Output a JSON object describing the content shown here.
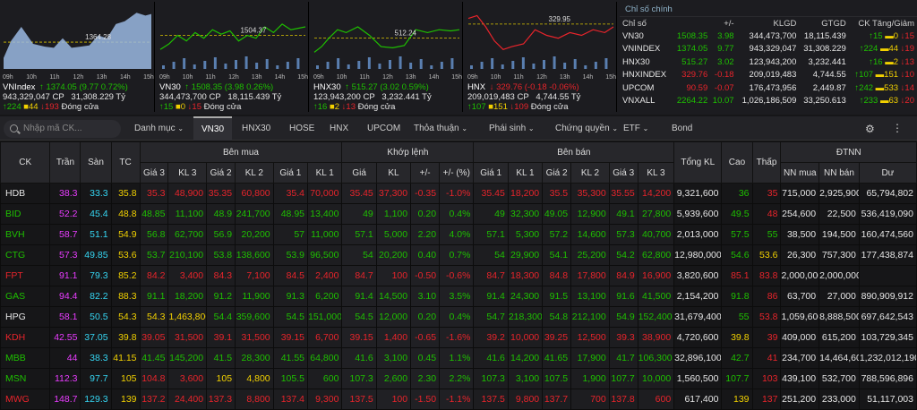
{
  "charts": [
    {
      "name": "VNIndex",
      "value": "1374.05",
      "change": "(9.77 0.72%)",
      "vol": "943,329,047 CP",
      "val": "31,308.229 Tỷ",
      "dir": "up",
      "up": "224",
      "ref": "44",
      "down": "193",
      "status": "Đóng cửa",
      "label": "1364.28",
      "times": [
        "09h",
        "10h",
        "11h",
        "12h",
        "13h",
        "14h",
        "15h"
      ]
    },
    {
      "name": "VN30",
      "value": "1508.35",
      "change": "(3.98 0.26%)",
      "vol": "344,473,700 CP",
      "val": "18,115.439 Tỷ",
      "dir": "up",
      "up": "15",
      "ref": "0",
      "down": "15",
      "status": "Đóng cửa",
      "label": "1504.37",
      "times": [
        "09h",
        "10h",
        "11h",
        "12h",
        "13h",
        "14h",
        "15h"
      ]
    },
    {
      "name": "HNX30",
      "value": "515.27",
      "change": "(3.02 0.59%)",
      "vol": "123,943,200 CP",
      "val": "3,232.441 Tỷ",
      "dir": "up",
      "up": "16",
      "ref": "2",
      "down": "13",
      "status": "Đóng cửa",
      "label": "512.24",
      "times": [
        "09h",
        "10h",
        "11h",
        "12h",
        "13h",
        "14h",
        "15h"
      ]
    },
    {
      "name": "HNX",
      "value": "329.76",
      "change": "(-0.18 -0.06%)",
      "vol": "209,019,483 CP",
      "val": "4,744.55 Tỷ",
      "dir": "dn",
      "up": "107",
      "ref": "151",
      "down": "109",
      "status": "Đóng cửa",
      "label": "329.95",
      "times": [
        "09h",
        "10h",
        "11h",
        "12h",
        "13h",
        "14h",
        "15h"
      ]
    }
  ],
  "index_panel": {
    "title": "Chỉ số chính",
    "headers": [
      "Chỉ số",
      "+/-",
      "KLGD",
      "GTGD",
      "CK Tăng/Giảm"
    ],
    "rows": [
      {
        "name": "VN30",
        "value": "1508.35",
        "chg": "3.98",
        "klgd": "344,473,700",
        "gtgd": "18,115.439",
        "up": "15",
        "ref": "0",
        "down": "15",
        "dir": "up"
      },
      {
        "name": "VNINDEX",
        "value": "1374.05",
        "chg": "9.77",
        "klgd": "943,329,047",
        "gtgd": "31,308.229",
        "up": "224",
        "ref": "44",
        "down": "19",
        "dir": "up"
      },
      {
        "name": "HNX30",
        "value": "515.27",
        "chg": "3.02",
        "klgd": "123,943,200",
        "gtgd": "3,232.441",
        "up": "16",
        "ref": "2",
        "down": "13",
        "dir": "up"
      },
      {
        "name": "HNXINDEX",
        "value": "329.76",
        "chg": "-0.18",
        "klgd": "209,019,483",
        "gtgd": "4,744.55",
        "up": "107",
        "ref": "151",
        "down": "10",
        "dir": "dn"
      },
      {
        "name": "UPCOM",
        "value": "90.59",
        "chg": "-0.07",
        "klgd": "176,473,956",
        "gtgd": "2,449.87",
        "up": "242",
        "ref": "533",
        "down": "14",
        "dir": "dn"
      },
      {
        "name": "VNXALL",
        "value": "2264.22",
        "chg": "10.07",
        "klgd": "1,026,186,509",
        "gtgd": "33,250.613",
        "up": "233",
        "ref": "63",
        "down": "20",
        "dir": "up"
      }
    ]
  },
  "toolbar": {
    "search_placeholder": "Nhập mã CK...",
    "tabs": [
      "Danh mục",
      "VN30",
      "HNX30",
      "HOSE",
      "HNX",
      "UPCOM",
      "Thỏa thuận",
      "Phái sinh",
      "Chứng quyền",
      "ETF",
      "Bond"
    ],
    "active": "VN30"
  },
  "table": {
    "groups": {
      "ck": "CK",
      "tran": "Trần",
      "san": "Sàn",
      "tc": "TC",
      "benmua": "Bên mua",
      "khoplenh": "Khớp lệnh",
      "benban": "Bên bán",
      "tongkl": "Tổng KL",
      "cao": "Cao",
      "thap": "Thấp",
      "dtnn": "ĐTNN"
    },
    "sub": [
      "Giá 3",
      "KL 3",
      "Giá 2",
      "KL 2",
      "Giá 1",
      "KL 1",
      "Giá",
      "KL",
      "+/-",
      "+/- (%)",
      "Giá 1",
      "KL 1",
      "Giá 2",
      "KL 2",
      "Giá 3",
      "KL 3",
      "NN mua",
      "NN bán",
      "Dư"
    ],
    "rows": [
      {
        "c": [
          "HDB",
          "38.3",
          "33.3",
          "35.8",
          "35.3",
          "48,900",
          "35.35",
          "60,800",
          "35.4",
          "70,000",
          "35.45",
          "37,300",
          "-0.35",
          "-1.0%",
          "35.45",
          "18,200",
          "35.5",
          "35,300",
          "35.55",
          "14,200",
          "9,321,600",
          "36",
          "35",
          "715,000",
          "2,925,900",
          "65,794,802"
        ],
        "k": [
          "wt",
          "ce",
          "fl",
          "ref",
          "dn",
          "dn",
          "dn",
          "dn",
          "dn",
          "dn",
          "dn",
          "dn",
          "dn",
          "dn",
          "dn",
          "dn",
          "dn",
          "dn",
          "dn",
          "dn",
          "wt",
          "up",
          "dn",
          "wt",
          "wt",
          "wt"
        ]
      },
      {
        "c": [
          "BID",
          "52.2",
          "45.4",
          "48.8",
          "48.85",
          "11,100",
          "48.9",
          "241,700",
          "48.95",
          "13,400",
          "49",
          "1,100",
          "0.20",
          "0.4%",
          "49",
          "32,300",
          "49.05",
          "12,900",
          "49.1",
          "27,800",
          "5,939,600",
          "49.5",
          "48",
          "254,600",
          "22,500",
          "536,419,090"
        ],
        "k": [
          "up",
          "ce",
          "fl",
          "ref",
          "up",
          "up",
          "up",
          "up",
          "up",
          "up",
          "up",
          "up",
          "up",
          "up",
          "up",
          "up",
          "up",
          "up",
          "up",
          "up",
          "wt",
          "up",
          "dn",
          "wt",
          "wt",
          "wt"
        ]
      },
      {
        "c": [
          "BVH",
          "58.7",
          "51.1",
          "54.9",
          "56.8",
          "62,700",
          "56.9",
          "20,200",
          "57",
          "11,000",
          "57.1",
          "5,000",
          "2.20",
          "4.0%",
          "57.1",
          "5,300",
          "57.2",
          "14,600",
          "57.3",
          "40,700",
          "2,013,000",
          "57.5",
          "55",
          "38,500",
          "194,500",
          "160,474,560"
        ],
        "k": [
          "up",
          "ce",
          "fl",
          "ref",
          "up",
          "up",
          "up",
          "up",
          "up",
          "up",
          "up",
          "up",
          "up",
          "up",
          "up",
          "up",
          "up",
          "up",
          "up",
          "up",
          "wt",
          "up",
          "up",
          "wt",
          "wt",
          "wt"
        ]
      },
      {
        "c": [
          "CTG",
          "57.3",
          "49.85",
          "53.6",
          "53.7",
          "210,100",
          "53.8",
          "138,600",
          "53.9",
          "96,500",
          "54",
          "20,200",
          "0.40",
          "0.7%",
          "54",
          "29,900",
          "54.1",
          "25,200",
          "54.2",
          "62,800",
          "12,980,000",
          "54.6",
          "53.6",
          "26,300",
          "757,300",
          "177,438,874"
        ],
        "k": [
          "up",
          "ce",
          "fl",
          "ref",
          "up",
          "up",
          "up",
          "up",
          "up",
          "up",
          "up",
          "up",
          "up",
          "up",
          "up",
          "up",
          "up",
          "up",
          "up",
          "up",
          "wt",
          "up",
          "ref",
          "wt",
          "wt",
          "wt"
        ]
      },
      {
        "c": [
          "FPT",
          "91.1",
          "79.3",
          "85.2",
          "84.2",
          "3,400",
          "84.3",
          "7,100",
          "84.5",
          "2,400",
          "84.7",
          "100",
          "-0.50",
          "-0.6%",
          "84.7",
          "18,300",
          "84.8",
          "17,800",
          "84.9",
          "16,900",
          "3,820,600",
          "85.1",
          "83.8",
          "2,000,000",
          "2,000,000",
          ""
        ],
        "k": [
          "dn",
          "ce",
          "fl",
          "ref",
          "dn",
          "dn",
          "dn",
          "dn",
          "dn",
          "dn",
          "dn",
          "dn",
          "dn",
          "dn",
          "dn",
          "dn",
          "dn",
          "dn",
          "dn",
          "dn",
          "wt",
          "dn",
          "dn",
          "wt",
          "wt",
          "wt"
        ]
      },
      {
        "c": [
          "GAS",
          "94.4",
          "82.2",
          "88.3",
          "91.1",
          "18,200",
          "91.2",
          "11,900",
          "91.3",
          "6,200",
          "91.4",
          "14,500",
          "3.10",
          "3.5%",
          "91.4",
          "24,300",
          "91.5",
          "13,100",
          "91.6",
          "41,500",
          "2,154,200",
          "91.8",
          "86",
          "63,700",
          "27,000",
          "890,909,912"
        ],
        "k": [
          "up",
          "ce",
          "fl",
          "ref",
          "up",
          "up",
          "up",
          "up",
          "up",
          "up",
          "up",
          "up",
          "up",
          "up",
          "up",
          "up",
          "up",
          "up",
          "up",
          "up",
          "wt",
          "up",
          "dn",
          "wt",
          "wt",
          "wt"
        ]
      },
      {
        "c": [
          "HPG",
          "58.1",
          "50.5",
          "54.3",
          "54.3",
          "1,463,800",
          "54.4",
          "359,600",
          "54.5",
          "151,000",
          "54.5",
          "12,000",
          "0.20",
          "0.4%",
          "54.7",
          "218,300",
          "54.8",
          "212,100",
          "54.9",
          "152,400",
          "31,679,400",
          "55",
          "53.8",
          "1,059,600",
          "8,888,500",
          "697,642,543"
        ],
        "k": [
          "wt",
          "ce",
          "fl",
          "ref",
          "ref",
          "ref",
          "up",
          "up",
          "up",
          "up",
          "up",
          "up",
          "up",
          "up",
          "up",
          "up",
          "up",
          "up",
          "up",
          "up",
          "wt",
          "up",
          "dn",
          "wt",
          "wt",
          "wt"
        ]
      },
      {
        "c": [
          "KDH",
          "42.55",
          "37.05",
          "39.8",
          "39.05",
          "31,500",
          "39.1",
          "31,500",
          "39.15",
          "6,700",
          "39.15",
          "1,400",
          "-0.65",
          "-1.6%",
          "39.2",
          "10,000",
          "39.25",
          "12,500",
          "39.3",
          "38,900",
          "4,720,600",
          "39.8",
          "39",
          "409,000",
          "615,200",
          "103,729,345"
        ],
        "k": [
          "dn",
          "ce",
          "fl",
          "ref",
          "dn",
          "dn",
          "dn",
          "dn",
          "dn",
          "dn",
          "dn",
          "dn",
          "dn",
          "dn",
          "dn",
          "dn",
          "dn",
          "dn",
          "dn",
          "dn",
          "wt",
          "ref",
          "dn",
          "wt",
          "wt",
          "wt"
        ]
      },
      {
        "c": [
          "MBB",
          "44",
          "38.3",
          "41.15",
          "41.45",
          "145,200",
          "41.5",
          "28,300",
          "41.55",
          "64,800",
          "41.6",
          "3,100",
          "0.45",
          "1.1%",
          "41.6",
          "14,200",
          "41.65",
          "17,900",
          "41.7",
          "106,300",
          "32,896,100",
          "42.7",
          "41",
          "234,700",
          "14,464,600",
          "1,232,012,190"
        ],
        "k": [
          "up",
          "ce",
          "fl",
          "ref",
          "up",
          "up",
          "up",
          "up",
          "up",
          "up",
          "up",
          "up",
          "up",
          "up",
          "up",
          "up",
          "up",
          "up",
          "up",
          "up",
          "wt",
          "up",
          "dn",
          "wt",
          "wt",
          "wt"
        ]
      },
      {
        "c": [
          "MSN",
          "112.3",
          "97.7",
          "105",
          "104.8",
          "3,600",
          "105",
          "4,800",
          "105.5",
          "600",
          "107.3",
          "2,600",
          "2.30",
          "2.2%",
          "107.3",
          "3,100",
          "107.5",
          "1,900",
          "107.7",
          "10,000",
          "1,560,500",
          "107.7",
          "103",
          "439,100",
          "532,700",
          "788,596,896"
        ],
        "k": [
          "up",
          "ce",
          "fl",
          "ref",
          "dn",
          "dn",
          "ref",
          "ref",
          "up",
          "up",
          "up",
          "up",
          "up",
          "up",
          "up",
          "up",
          "up",
          "up",
          "up",
          "up",
          "wt",
          "up",
          "dn",
          "wt",
          "wt",
          "wt"
        ]
      },
      {
        "c": [
          "MWG",
          "148.7",
          "129.3",
          "139",
          "137.2",
          "24,400",
          "137.3",
          "8,800",
          "137.4",
          "9,300",
          "137.5",
          "100",
          "-1.50",
          "-1.1%",
          "137.5",
          "9,800",
          "137.7",
          "700",
          "137.8",
          "600",
          "617,400",
          "139",
          "137",
          "251,200",
          "233,000",
          "51,117,003"
        ],
        "k": [
          "dn",
          "ce",
          "fl",
          "ref",
          "dn",
          "dn",
          "dn",
          "dn",
          "dn",
          "dn",
          "dn",
          "dn",
          "dn",
          "dn",
          "dn",
          "dn",
          "dn",
          "dn",
          "dn",
          "dn",
          "wt",
          "ref",
          "dn",
          "wt",
          "wt",
          "wt"
        ]
      }
    ]
  }
}
